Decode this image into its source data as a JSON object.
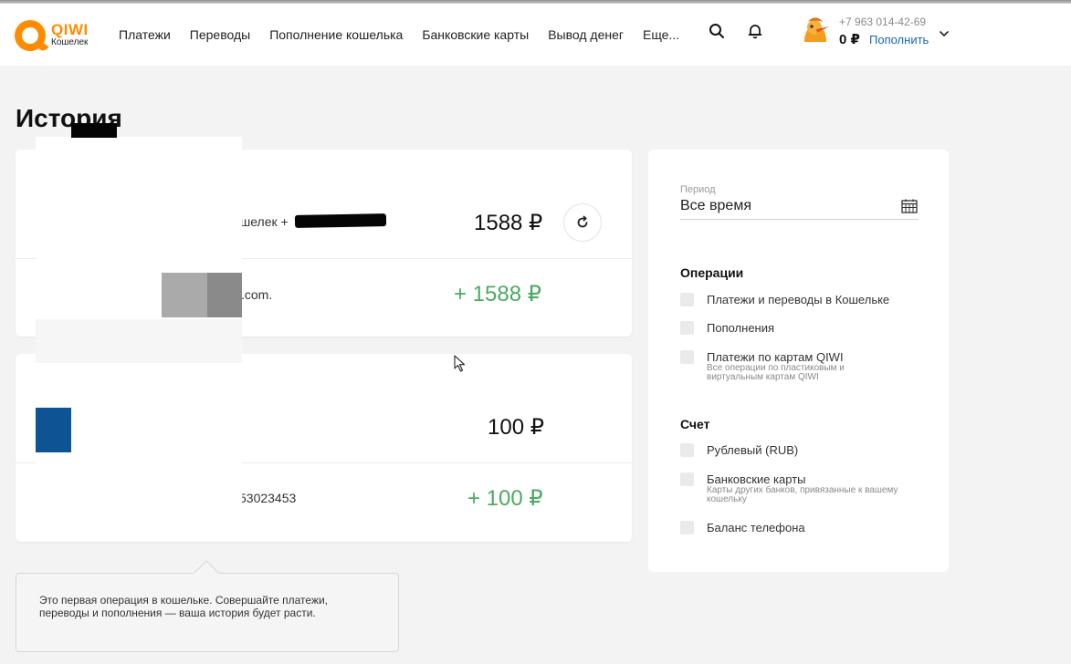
{
  "brand": {
    "name": "QIWI",
    "sub": "Кошелек",
    "color": "#ff8c00"
  },
  "nav": {
    "items": [
      "Платежи",
      "Переводы",
      "Пополнение кошелька",
      "Банковские карты",
      "Вывод денег",
      "Еще..."
    ],
    "search_icon": "search-icon",
    "bell_icon": "bell-icon"
  },
  "account": {
    "phone": "+7 963 014-42-69",
    "balance": "0 ₽",
    "topup_label": "Пополнить",
    "chevron_icon": "chevron-down-icon"
  },
  "page": {
    "title": "История"
  },
  "history": [
    {
      "top_desc": "шелек +",
      "amount": "1588 ₽",
      "bottom_desc": ".com.",
      "credit": "+ 1588 ₽"
    },
    {
      "amount": "100 ₽",
      "bottom_desc": "53023453",
      "credit": "+ 100 ₽"
    }
  ],
  "filters": {
    "period": {
      "label": "Период",
      "value": "Все время"
    },
    "operations": {
      "title": "Операции",
      "items": [
        {
          "label": "Платежи и переводы в Кошельке",
          "sub": ""
        },
        {
          "label": "Пополнения",
          "sub": ""
        },
        {
          "label": "Платежи по картам QIWI",
          "sub": "Все операции по пластиковым и виртуальным картам QIWI"
        }
      ]
    },
    "account": {
      "title": "Счет",
      "items": [
        {
          "label": "Рублевый (RUB)",
          "sub": ""
        },
        {
          "label": "Банковские карты",
          "sub": "Карты других банков, привязанные к вашему кошельку"
        },
        {
          "label": "Баланс телефона",
          "sub": ""
        }
      ]
    }
  },
  "tooltip": {
    "text": "Это первая операция в кошельке. Совершайте платежи, переводы и пополнения — ваша история будет расти."
  },
  "colors": {
    "credit": "#4caa5f",
    "link": "#1a64b8",
    "background": "#f3f3f3"
  }
}
